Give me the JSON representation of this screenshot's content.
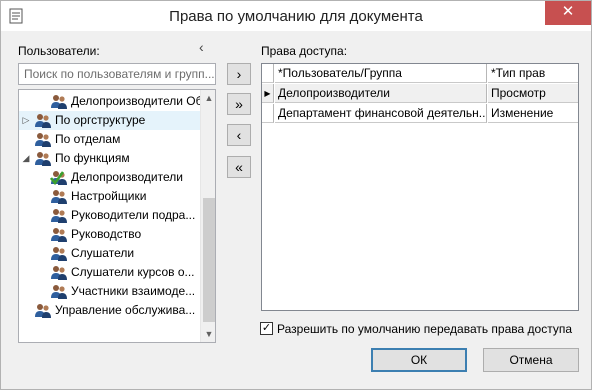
{
  "window": {
    "title": "Права по умолчанию для документа",
    "close_glyph": "✕"
  },
  "users_panel": {
    "label": "Пользователи:",
    "collapse_glyph": "‹",
    "search_placeholder": "Поиск по пользователям и групп...",
    "tree": [
      {
        "label": "Делопроизводители Об...",
        "icon": "users-group-icon",
        "toggle": "",
        "level": 1
      },
      {
        "label": "По оргструктуре",
        "icon": "users-group-icon",
        "toggle": "▷",
        "level": 0
      },
      {
        "label": "По отделам",
        "icon": "users-group-icon",
        "toggle": "",
        "level": 0
      },
      {
        "label": "По функциям",
        "icon": "users-group-icon",
        "toggle": "◢",
        "level": 0
      },
      {
        "label": "Делопроизводители",
        "icon": "users-group-checked-icon",
        "toggle": "",
        "level": 1
      },
      {
        "label": "Настройщики",
        "icon": "users-group-icon",
        "toggle": "",
        "level": 1
      },
      {
        "label": "Руководители подра...",
        "icon": "users-group-icon",
        "toggle": "",
        "level": 1
      },
      {
        "label": "Руководство",
        "icon": "users-group-icon",
        "toggle": "",
        "level": 1
      },
      {
        "label": "Слушатели",
        "icon": "users-group-icon",
        "toggle": "",
        "level": 1
      },
      {
        "label": "Слушатели курсов о...",
        "icon": "users-group-icon",
        "toggle": "",
        "level": 1
      },
      {
        "label": "Участники взаимоде...",
        "icon": "users-group-icon",
        "toggle": "",
        "level": 1
      },
      {
        "label": "Управление обслужива...",
        "icon": "users-group-icon",
        "toggle": "",
        "level": 0
      }
    ],
    "scroll_up_glyph": "▲",
    "scroll_down_glyph": "▼"
  },
  "move_buttons": {
    "add": "›",
    "add_all": "»",
    "remove": "‹",
    "remove_all": "«"
  },
  "access_panel": {
    "label": "Права доступа:",
    "columns": [
      "*Пользователь/Группа",
      "*Тип прав"
    ],
    "rows": [
      {
        "user": "Делопроизводители",
        "right": "Просмотр",
        "selected": true,
        "indicator": "▶"
      },
      {
        "user": "Департамент финансовой деятельн...",
        "right": "Изменение",
        "selected": false,
        "indicator": ""
      }
    ]
  },
  "options": {
    "pass_rights_label": "Разрешить по умолчанию передавать права доступа",
    "pass_rights_checked": true,
    "check_glyph": "✓"
  },
  "buttons": {
    "ok": "ОК",
    "cancel": "Отмена"
  },
  "colors": {
    "close_button": "#c75050",
    "user_icon_blue": "#2f5f9e",
    "check_green": "#3aa02e"
  }
}
